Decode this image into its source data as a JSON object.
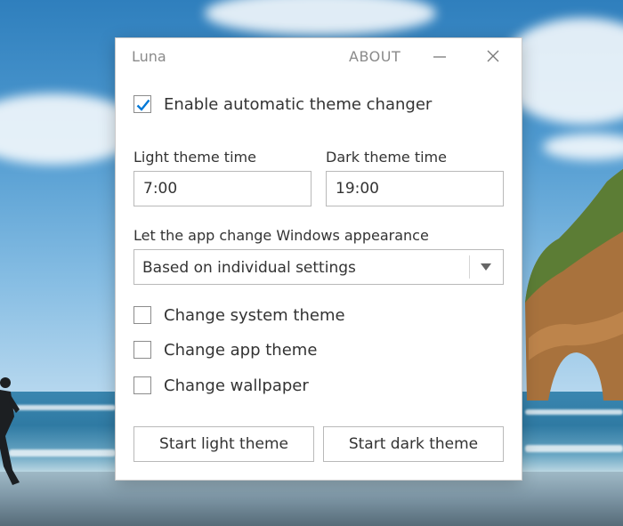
{
  "window": {
    "title": "Luna",
    "about_label": "ABOUT"
  },
  "auto_changer": {
    "label": "Enable automatic theme changer",
    "checked": true
  },
  "light_time": {
    "label": "Light theme time",
    "value": "7:00"
  },
  "dark_time": {
    "label": "Dark theme time",
    "value": "19:00"
  },
  "appearance": {
    "label": "Let the app change Windows appearance",
    "selected": "Based on individual settings"
  },
  "options": [
    {
      "label": "Change system theme",
      "checked": false
    },
    {
      "label": "Change app theme",
      "checked": false
    },
    {
      "label": "Change wallpaper",
      "checked": false
    }
  ],
  "buttons": {
    "light": "Start light theme",
    "dark": "Start dark theme"
  },
  "colors": {
    "accent": "#0078d7",
    "text": "#333333",
    "muted": "#8a8a8a",
    "border": "#b9b9b9"
  },
  "icons": {
    "checkmark": "check-icon",
    "minimize": "minimize-icon",
    "close": "close-icon",
    "dropdown": "chevron-down-icon"
  }
}
